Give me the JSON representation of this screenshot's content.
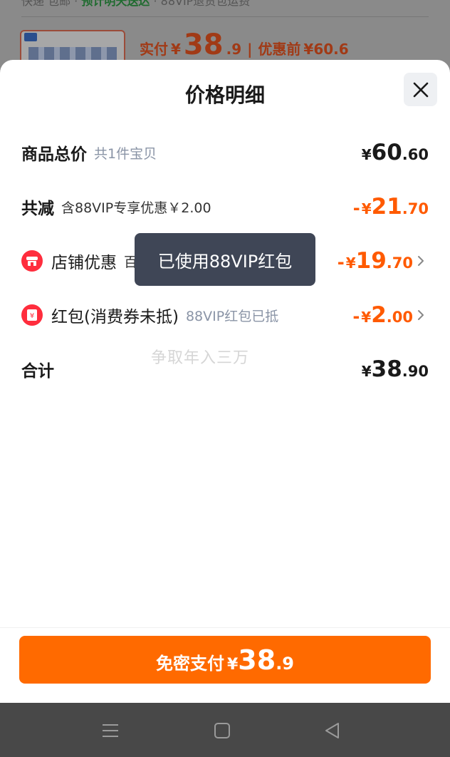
{
  "background": {
    "delivery_text_prefix": "快递 包邮 · ",
    "delivery_text_highlight": "预计明天送达",
    "delivery_text_suffix": " · 88VIP退货包运费",
    "price_label": "实付",
    "currency": "¥",
    "price_int": "38",
    "price_dec": ".9",
    "price_separator": "|",
    "original_label": "优惠前",
    "original_price": "¥60.6"
  },
  "sheet": {
    "title": "价格明细",
    "close_icon": "close-icon"
  },
  "rows": {
    "total": {
      "label": "商品总价",
      "sub": "共1件宝贝",
      "currency": "¥",
      "int": "60",
      "dec": ".60"
    },
    "discount": {
      "label": "共减",
      "sub": "含88VIP专享优惠￥2.00",
      "minus": "-",
      "currency": "¥",
      "int": "21",
      "dec": ".70"
    },
    "shop": {
      "icon": "shop-icon",
      "label": "店铺优惠",
      "sub": "百亿",
      "minus": "-",
      "currency": "¥",
      "int": "19",
      "dec": ".70"
    },
    "redpacket": {
      "icon": "red-packet-icon",
      "label": "红包(消费券未抵)",
      "sub": "88VIP红包已抵",
      "minus": "-",
      "currency": "¥",
      "int": "2",
      "dec": ".00"
    },
    "sum": {
      "label": "合计",
      "currency": "¥",
      "int": "38",
      "dec": ".90"
    }
  },
  "toast": "已使用88VIP红包",
  "watermark": "争取年入三万",
  "pay_button": {
    "label": "免密支付",
    "currency": "¥",
    "int": "38",
    "dec": ".9"
  },
  "colors": {
    "accent": "#ff6a00",
    "discount": "#ff5a00",
    "badge": "#ff2d3d"
  }
}
